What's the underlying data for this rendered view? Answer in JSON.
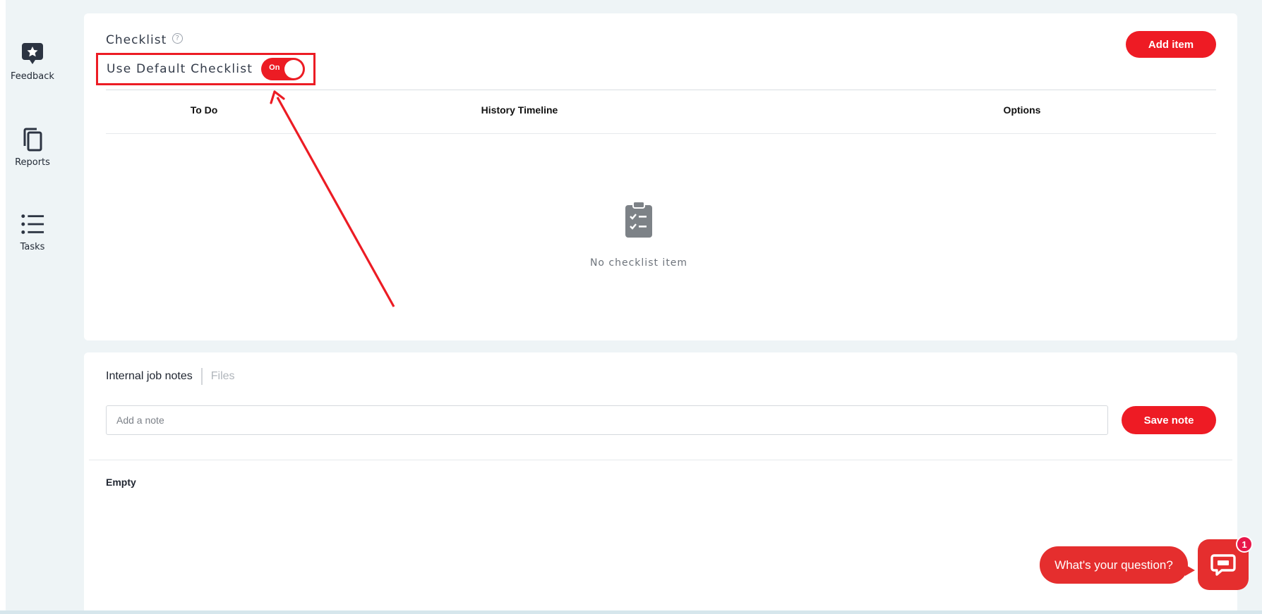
{
  "sidebar": {
    "items": [
      {
        "label": "Feedback",
        "icon": "feedback-star-icon"
      },
      {
        "label": "Reports",
        "icon": "copy-pages-icon"
      },
      {
        "label": "Tasks",
        "icon": "list-icon"
      }
    ]
  },
  "checklist": {
    "title": "Checklist",
    "help_glyph": "?",
    "default_label": "Use Default Checklist",
    "toggle_text": "On",
    "toggle_state": "on",
    "add_button": "Add item",
    "columns": [
      "To Do",
      "History Timeline",
      "Options"
    ],
    "empty_text": "No checklist item"
  },
  "notes": {
    "tabs": [
      "Internal job notes",
      "Files"
    ],
    "active_tab": "Internal job notes",
    "input_placeholder": "Add a note",
    "input_value": "",
    "save_button": "Save note",
    "empty_text": "Empty"
  },
  "chat": {
    "bubble_text": "What's your question?",
    "badge_count": "1"
  },
  "colors": {
    "accent": "#ee1b24",
    "background": "#eef4f6",
    "badge": "#e8174a"
  }
}
